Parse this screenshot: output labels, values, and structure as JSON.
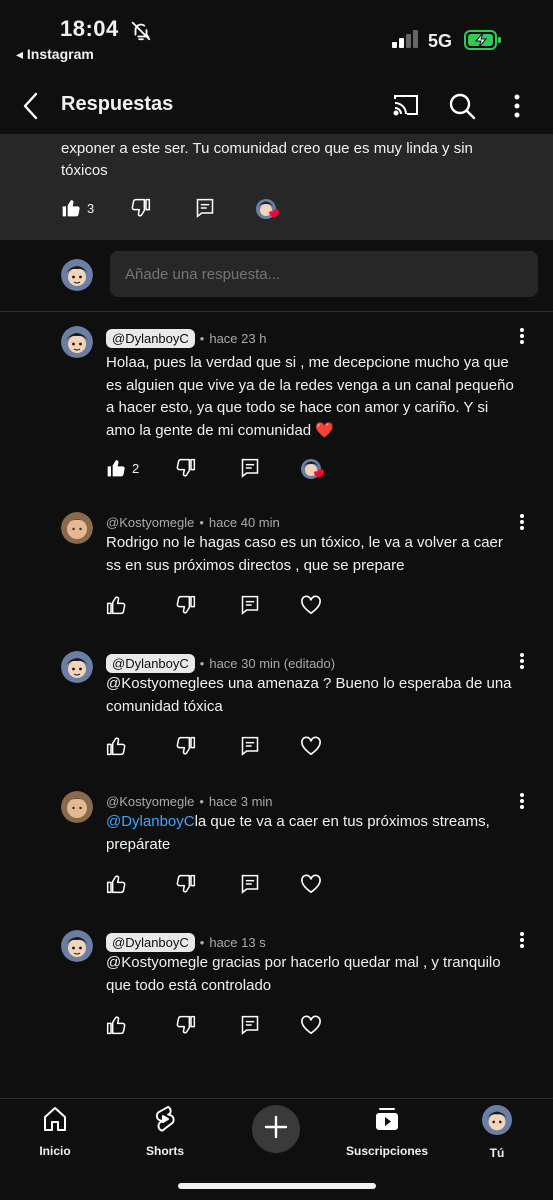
{
  "status_bar": {
    "time": "18:04",
    "back_app": "◂ Instagram",
    "network": "5G",
    "icons": [
      "bell-slash-icon",
      "signal-icon",
      "battery-charging-icon"
    ]
  },
  "app_bar": {
    "title": "Respuestas",
    "icons": [
      "back-arrow-icon",
      "cast-icon",
      "search-icon",
      "more-vert-icon"
    ]
  },
  "parent_comment": {
    "text_line1": "exponer a este ser. Tu comunidad creo que es muy linda y sin",
    "text_line2": "tóxicos",
    "likes": "3"
  },
  "reply_box": {
    "placeholder": "Añade una respuesta..."
  },
  "replies": [
    {
      "handle": "@DylanboyC",
      "time": "hace 23 h",
      "text": "Holaa, pues la verdad que si , me decepcione mucho ya que es alguien que vive ya de la redes venga a un canal pequeño a hacer esto, ya que todo se hace con amor y cariño. Y si amo la gente de mi comunidad ❤️",
      "likes": "2"
    },
    {
      "handle": "@Kostyomegle",
      "time": "hace 40 min",
      "text": "Rodrigo no le hagas caso es un tóxico, le va a volver a caer ss en sus próximos directos , que se prepare"
    },
    {
      "handle": "@DylanboyC",
      "time": "hace 30 min (editado)",
      "text": "@Kostyomeglees una amenaza ? Bueno lo esperaba de una  comunidad tóxica"
    },
    {
      "handle": "@Kostyomegle",
      "time": "hace 3 min",
      "mention": "@DylanboyC",
      "text": "la que te va a caer en tus próximos streams, prepárate"
    },
    {
      "handle": "@DylanboyC",
      "time": "hace 13 s",
      "text": "@Kostyomegle gracias por hacerlo quedar mal , y tranquilo que todo está controlado"
    }
  ],
  "bottom_nav": {
    "inicio": "Inicio",
    "shorts": "Shorts",
    "suscripciones": "Suscripciones",
    "tu": "Tú"
  },
  "colors": {
    "background": "#0f0f0f",
    "surface": "#272727",
    "text": "#f1f1f1",
    "muted": "#aaaaaa",
    "mention": "#3ea6ff",
    "heart": "#ff0033",
    "battery": "#34c759"
  }
}
